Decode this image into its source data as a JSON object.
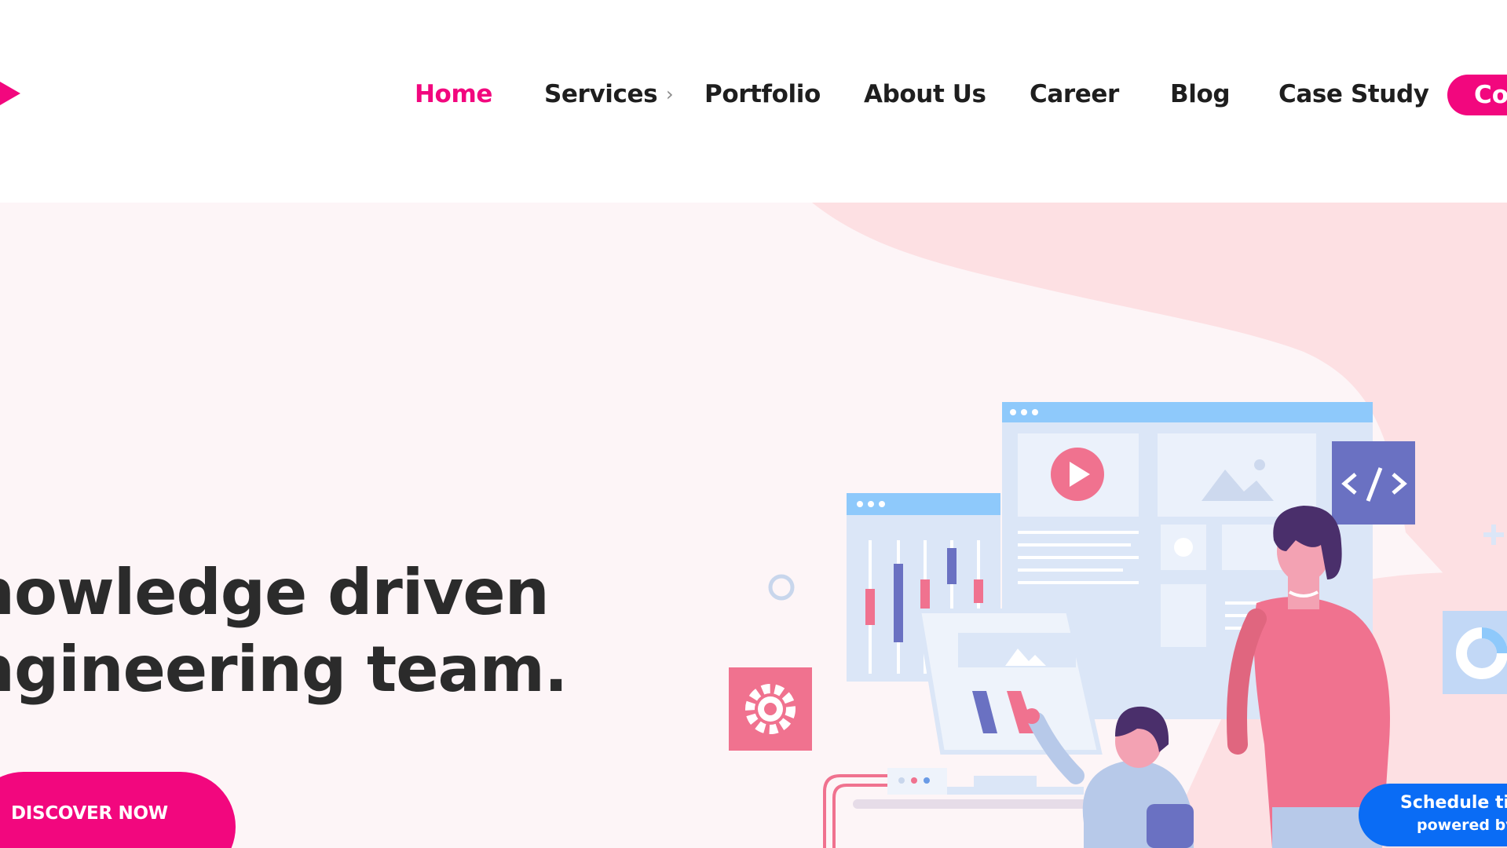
{
  "colors": {
    "brand_pink": "#f2077e",
    "nav_text": "#1e1e1e",
    "hero_bg": "#fdf5f7",
    "hero_blob": "#fde0e3",
    "widget_blue": "#0a6cf5"
  },
  "header": {
    "logo_icon": "play-arrow-logo",
    "nav": {
      "home": "Home",
      "services": "Services",
      "services_chevron": "›",
      "portfolio": "Portfolio",
      "about": "About Us",
      "career": "Career",
      "blog": "Blog",
      "case_study": "Case Study"
    },
    "cta_label": "Co"
  },
  "hero": {
    "headline_line1": "nowledge driven",
    "headline_line2": "ngineering team.",
    "discover_label": "DISCOVER NOW",
    "illustration_icons": [
      "play-icon",
      "image-icon",
      "code-icon",
      "gear-icon",
      "donut-chart-icon",
      "plus-icon"
    ]
  },
  "schedule_widget": {
    "title": "Schedule tir",
    "subtitle": "powered by"
  }
}
